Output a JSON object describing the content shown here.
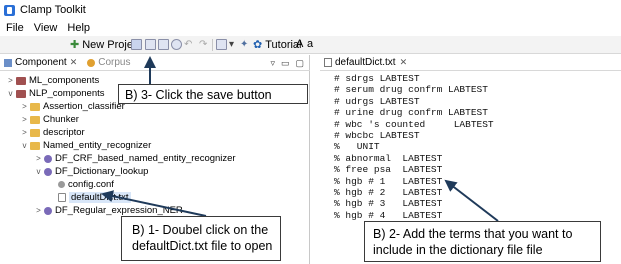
{
  "window": {
    "title": "Clamp Toolkit"
  },
  "menu": [
    "File",
    "View",
    "Help"
  ],
  "toolbar": {
    "new_project": "New Project",
    "tutorial": "Tutorial",
    "font_a_large": "A",
    "font_a_small": "a"
  },
  "left_panel": {
    "tabs": [
      {
        "label": "Component",
        "close": "✕"
      },
      {
        "label": "Corpus"
      }
    ],
    "tree": [
      {
        "label": "ML_components",
        "twisty": ">",
        "icon": "proj"
      },
      {
        "label": "NLP_components",
        "twisty": "v",
        "icon": "proj"
      },
      {
        "label": "Assertion_classifier",
        "twisty": ">",
        "icon": "folder"
      },
      {
        "label": "Chunker",
        "twisty": ">",
        "icon": "folder"
      },
      {
        "label": "descriptor",
        "twisty": ">",
        "icon": "folder"
      },
      {
        "label": "Named_entity_recognizer",
        "twisty": "v",
        "icon": "folder"
      },
      {
        "label": "DF_CRF_based_named_entity_recognizer",
        "twisty": ">",
        "icon": "comp"
      },
      {
        "label": "DF_Dictionary_lookup",
        "twisty": "v",
        "icon": "comp"
      },
      {
        "label": "config.conf",
        "twisty": "",
        "icon": "cfg"
      },
      {
        "label": "defaultDict.txt",
        "twisty": "",
        "icon": "file",
        "selected": true
      },
      {
        "label": "DF_Regular_expression_NER",
        "twisty": ">",
        "icon": "comp"
      }
    ]
  },
  "editor": {
    "tab": {
      "label": "defaultDict.txt",
      "close": "✕"
    },
    "lines": [
      "# sdrgs LABTEST",
      "# serum drug confrm LABTEST",
      "# udrgs LABTEST",
      "# urine drug confrm LABTEST",
      "# wbc 's counted     LABTEST",
      "# wbcbc LABTEST",
      "%   UNIT",
      "% abnormal  LABTEST",
      "% free psa  LABTEST",
      "% hgb # 1   LABTEST",
      "% hgb # 2   LABTEST",
      "% hgb # 3   LABTEST",
      "% hgb # 4   LABTEST"
    ]
  },
  "callouts": {
    "save": "B) 3- Click the save button",
    "open_line1": "B) 1- Doubel  click on the",
    "open_line2": "defaultDict.txt  file to open",
    "add_line1": "B) 2- Add the terms  that you want to",
    "add_line2": "include in the dictionary  file file"
  },
  "colors": {
    "callout_border": "#3a3a3a",
    "arrow": "#1f3a5a",
    "selection": "#d8e6f8"
  }
}
